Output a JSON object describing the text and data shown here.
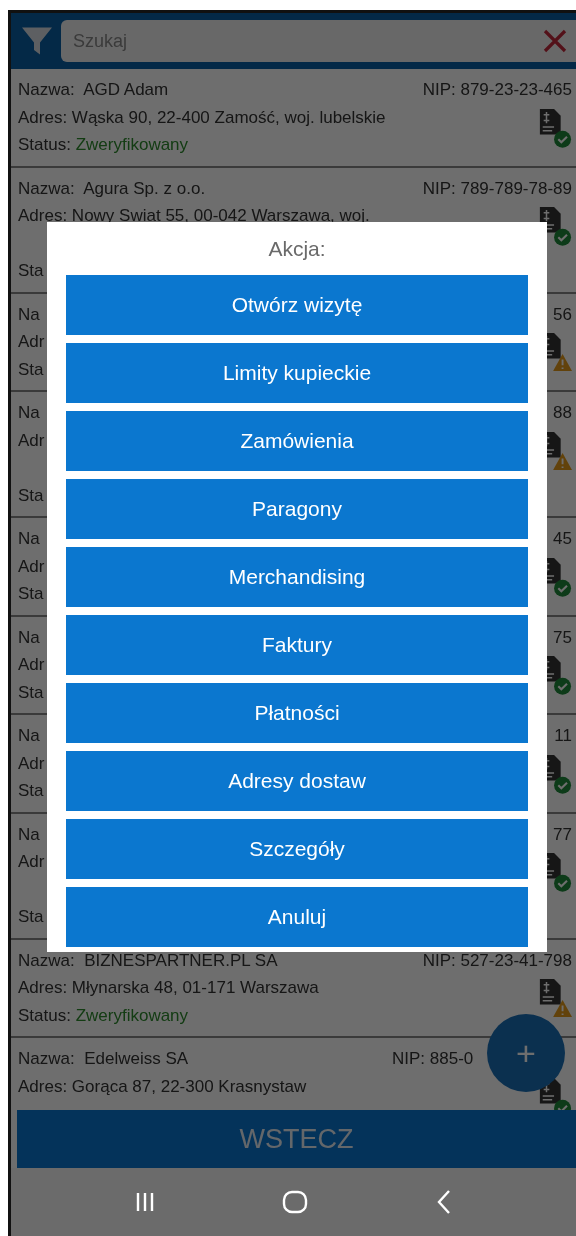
{
  "search": {
    "placeholder": "Szukaj"
  },
  "clients": [
    {
      "kind": "single",
      "name": "Nazwa:  AGD Adam",
      "nip": "NIP: 879-23-23-465",
      "address": "Adres: Wąska 90, 22-400 Zamość, woj. lubelskie",
      "status_label": "Status:",
      "status": "Zweryfikowany",
      "verified": true
    },
    {
      "kind": "wrapped",
      "name": "Nazwa:  Agura Sp. z o.o.",
      "nip": "NIP: 789-789-78-89",
      "address": "Adres: Nowy Swiat 55, 00-042 Warszawa, woj.",
      "status_label": "Sta",
      "verified": true
    },
    {
      "kind": "single",
      "name": "Na",
      "nip": "56",
      "address": "Adr",
      "status_label": "Sta",
      "verified": false
    },
    {
      "kind": "wrapped",
      "name": "Na",
      "nip": "88",
      "address": "Adr",
      "status_label": "Sta",
      "verified": false
    },
    {
      "kind": "single",
      "name": "Na",
      "nip": "45",
      "address": "Adr",
      "status_label": "Sta",
      "verified": true
    },
    {
      "kind": "single",
      "name": "Na",
      "nip": "75",
      "address": "Adr",
      "status_label": "Sta",
      "verified": true
    },
    {
      "kind": "single",
      "name": "Na",
      "nip": "11",
      "address": "Adr",
      "status_label": "Sta",
      "verified": true
    },
    {
      "kind": "wrapped",
      "name": "Na",
      "nip": "77",
      "address": "Adr",
      "status_label": "Sta",
      "verified": true
    },
    {
      "kind": "single",
      "name": "Nazwa:  BIZNESPARTNER.PL SA",
      "nip": "NIP: 527-23-41-798",
      "address": "Adres: Młynarska 48, 01-171 Warszawa",
      "status_label": "Status:",
      "status": "Zweryfikowany",
      "verified": false
    },
    {
      "kind": "cut",
      "name": "Nazwa:  Edelweiss SA",
      "nip": "NIP: 885-0",
      "address": "Adres: Gorąca 87, 22-300 Krasnystaw",
      "verified": true
    }
  ],
  "back_button": "WSTECZ",
  "fab": "+",
  "dialog": {
    "title": "Akcja:",
    "actions": [
      "Otwórz wizytę",
      "Limity kupieckie",
      "Zamówienia",
      "Paragony",
      "Merchandising",
      "Faktury",
      "Płatności",
      "Adresy dostaw",
      "Szczegóły",
      "Anuluj"
    ]
  }
}
